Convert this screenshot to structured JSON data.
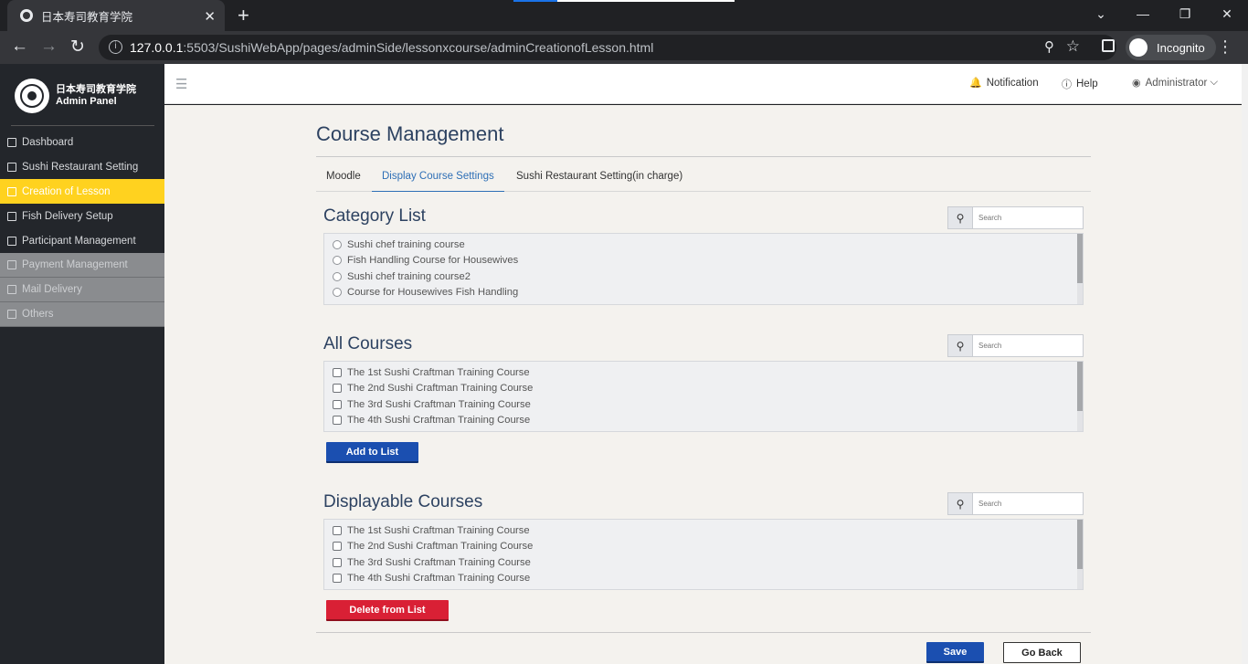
{
  "browser": {
    "tab_title": "日本寿司教育学院",
    "url_host": "127.0.0.1",
    "url_rest": ":5503/SushiWebApp/pages/adminSide/lessonxcourse/adminCreationofLesson.html",
    "profile": "Incognito"
  },
  "sidebar": {
    "brand_line1": "日本寿司教育学院",
    "brand_line2": "Admin Panel",
    "items": [
      {
        "label": "Dashboard",
        "state": "normal"
      },
      {
        "label": "Sushi Restaurant Setting",
        "state": "normal"
      },
      {
        "label": "Creation of Lesson",
        "state": "active"
      },
      {
        "label": "Fish Delivery Setup",
        "state": "normal"
      },
      {
        "label": "Participant Management",
        "state": "normal"
      },
      {
        "label": "Payment Management",
        "state": "disabled"
      },
      {
        "label": "Mail Delivery",
        "state": "disabled"
      },
      {
        "label": "Others",
        "state": "disabled"
      }
    ]
  },
  "topbar": {
    "notification": "Notification",
    "help": "Help",
    "user": "Administrator"
  },
  "main": {
    "title": "Course Management",
    "tabs": [
      {
        "label": "Moodle",
        "active": false
      },
      {
        "label": "Display Course Settings",
        "active": true
      },
      {
        "label": "Sushi Restaurant Setting(in charge)",
        "active": false
      }
    ],
    "search_placeholder": "Search",
    "category_list": {
      "title": "Category List",
      "items": [
        "Sushi chef training course",
        "Fish Handling Course for Housewives",
        "Sushi chef training course2",
        "Course for Housewives Fish Handling"
      ]
    },
    "all_courses": {
      "title": "All Courses",
      "items": [
        "The 1st Sushi Craftman Training Course",
        "The 2nd Sushi Craftman Training Course",
        "The 3rd Sushi Craftman Training Course",
        "The 4th Sushi Craftman Training Course"
      ],
      "button": "Add to List"
    },
    "displayable_courses": {
      "title": "Displayable Courses",
      "items": [
        "The 1st Sushi Craftman Training Course",
        "The 2nd Sushi Craftman Training Course",
        "The 3rd Sushi Craftman Training Course",
        "The 4th Sushi Craftman Training Course"
      ],
      "button": "Delete from List"
    },
    "save_label": "Save",
    "back_label": "Go Back"
  },
  "colors": {
    "accent_active": "#ffd21f",
    "primary_button": "#1b4fb0",
    "danger_button": "#d92035",
    "heading": "#2d4261"
  }
}
